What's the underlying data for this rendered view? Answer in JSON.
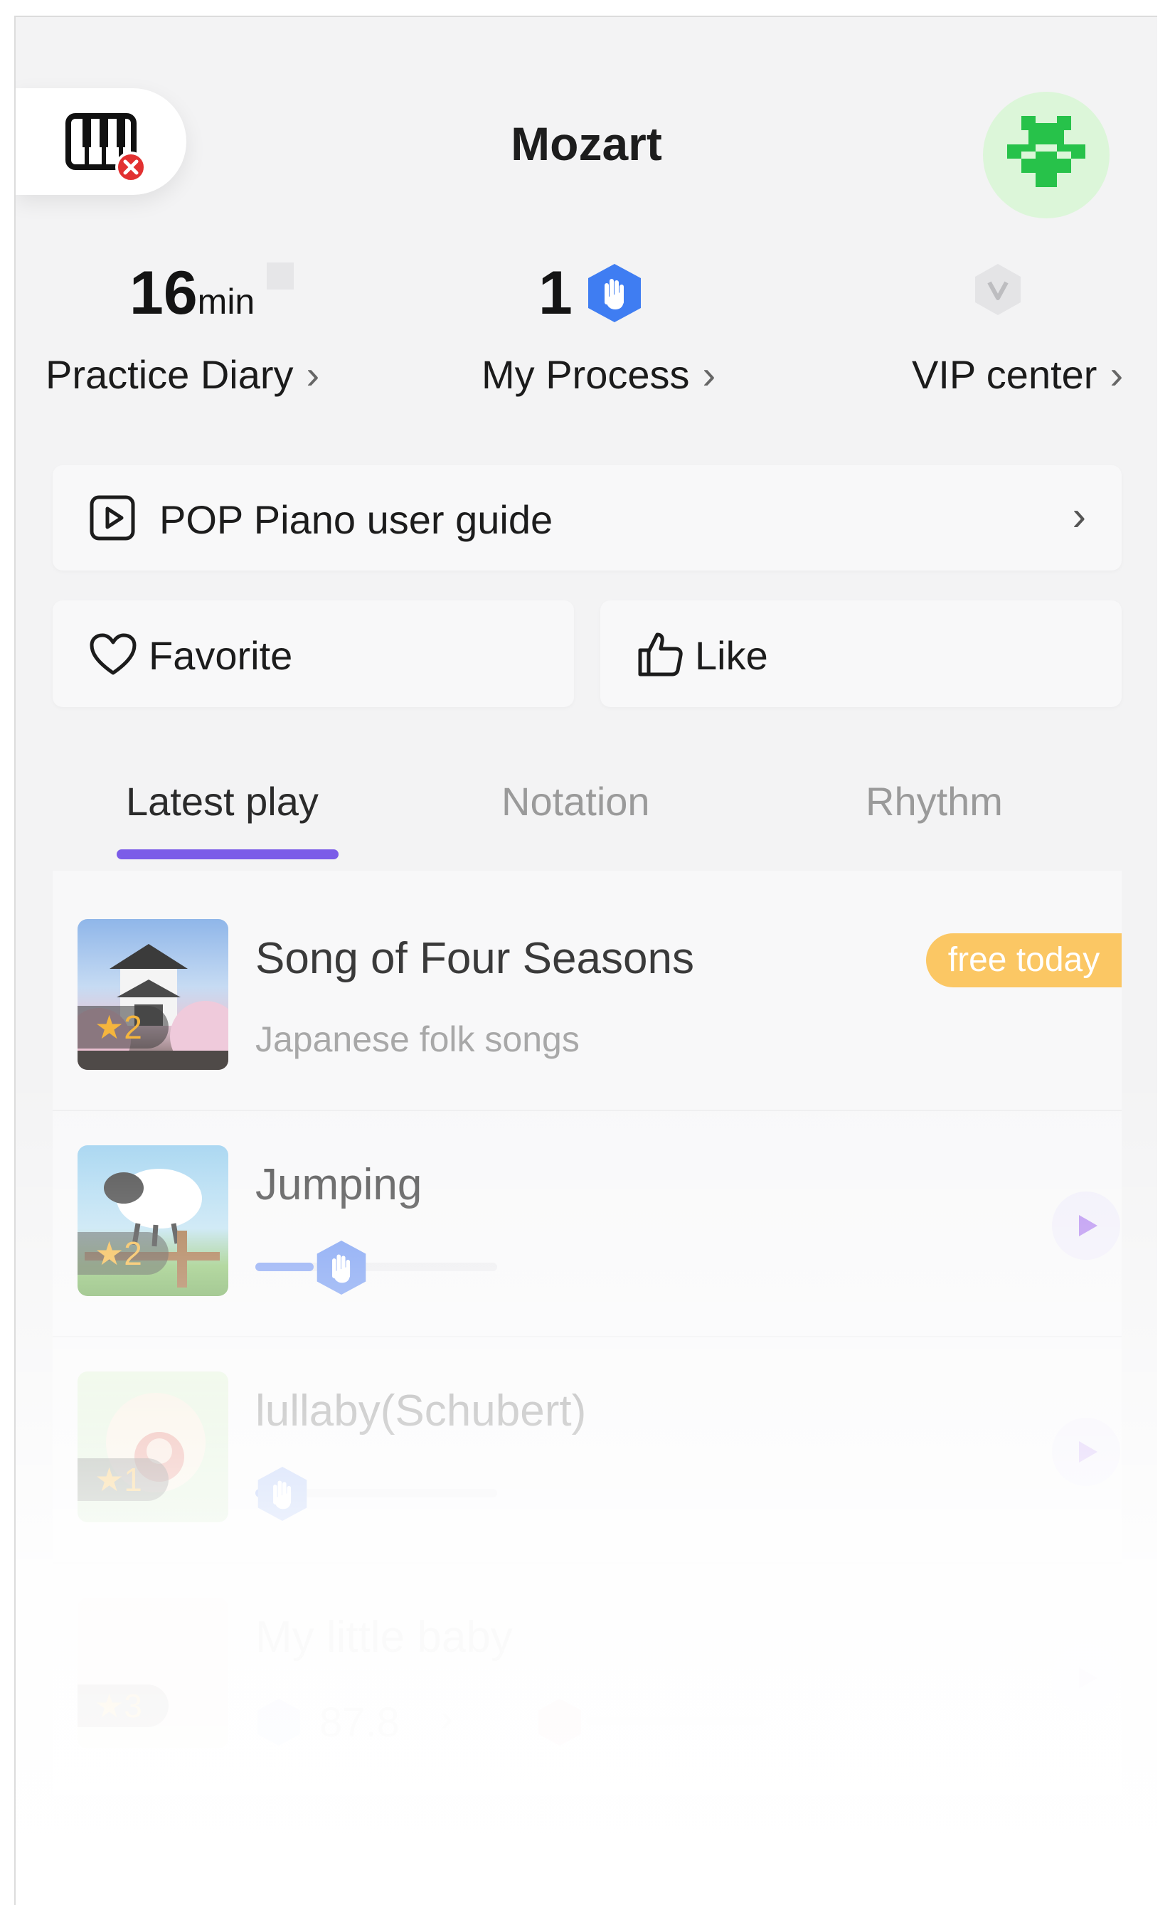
{
  "header": {
    "title": "Mozart",
    "piano_icon": "piano-disconnected-icon",
    "avatar_icon": "pixel-avatar-icon"
  },
  "stats": {
    "practice": {
      "value": "16",
      "unit": "min",
      "label": "Practice Diary"
    },
    "process": {
      "value": "1",
      "label": "My Process"
    },
    "vip": {
      "label": "VIP center"
    }
  },
  "guide": {
    "label": "POP Piano user guide",
    "icon": "play-square-icon"
  },
  "actions": {
    "favorite": {
      "label": "Favorite",
      "icon": "heart-icon"
    },
    "like": {
      "label": "Like",
      "icon": "thumbs-up-icon"
    }
  },
  "tabs": [
    {
      "label": "Latest play",
      "active": true
    },
    {
      "label": "Notation",
      "active": false
    },
    {
      "label": "Rhythm",
      "active": false
    }
  ],
  "songs": [
    {
      "title": "Song of Four Seasons",
      "subtitle": "Japanese folk songs",
      "stars": "★2",
      "badge": "free today"
    },
    {
      "title": "Jumping",
      "stars": "★2",
      "progress": 0.24
    },
    {
      "title": "lullaby(Schubert)",
      "stars": "★1",
      "progress": 0.11
    },
    {
      "title": "My little baby",
      "stars": "★3",
      "score": "87.8",
      "progress": 0
    }
  ],
  "colors": {
    "accent": "#7b5ce8",
    "badge": "#fbc764",
    "hand_blue": "#3f7df2",
    "avatar_green": "#27c24a"
  }
}
